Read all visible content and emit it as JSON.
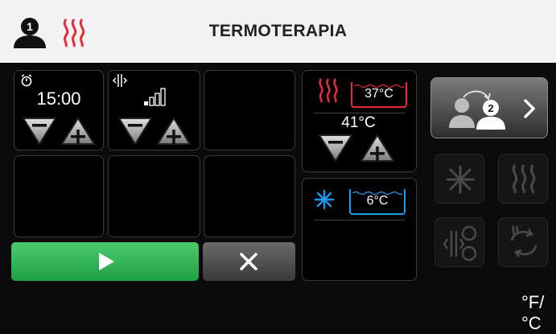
{
  "header": {
    "title": "TERMOTERAPIA",
    "user_badge": "1"
  },
  "timer": {
    "icon": "timer-icon",
    "value": "15:00"
  },
  "vibration": {
    "icon": "vibration-icon",
    "level_icon": "signal-bars-icon"
  },
  "heat_zone": {
    "icon": "heat-waves-icon",
    "water_temp": "37°C",
    "set_temp": "41°C",
    "color": "#e8293a"
  },
  "cold_zone": {
    "icon": "snowflake-icon",
    "water_temp": "6°C",
    "color": "#1e9bea"
  },
  "controls": {
    "next_patient_badge": "2"
  },
  "units": {
    "label": "°F/°C"
  },
  "colors": {
    "start": "#2db552",
    "accent": "#e8293a",
    "cold": "#1e9bea"
  }
}
